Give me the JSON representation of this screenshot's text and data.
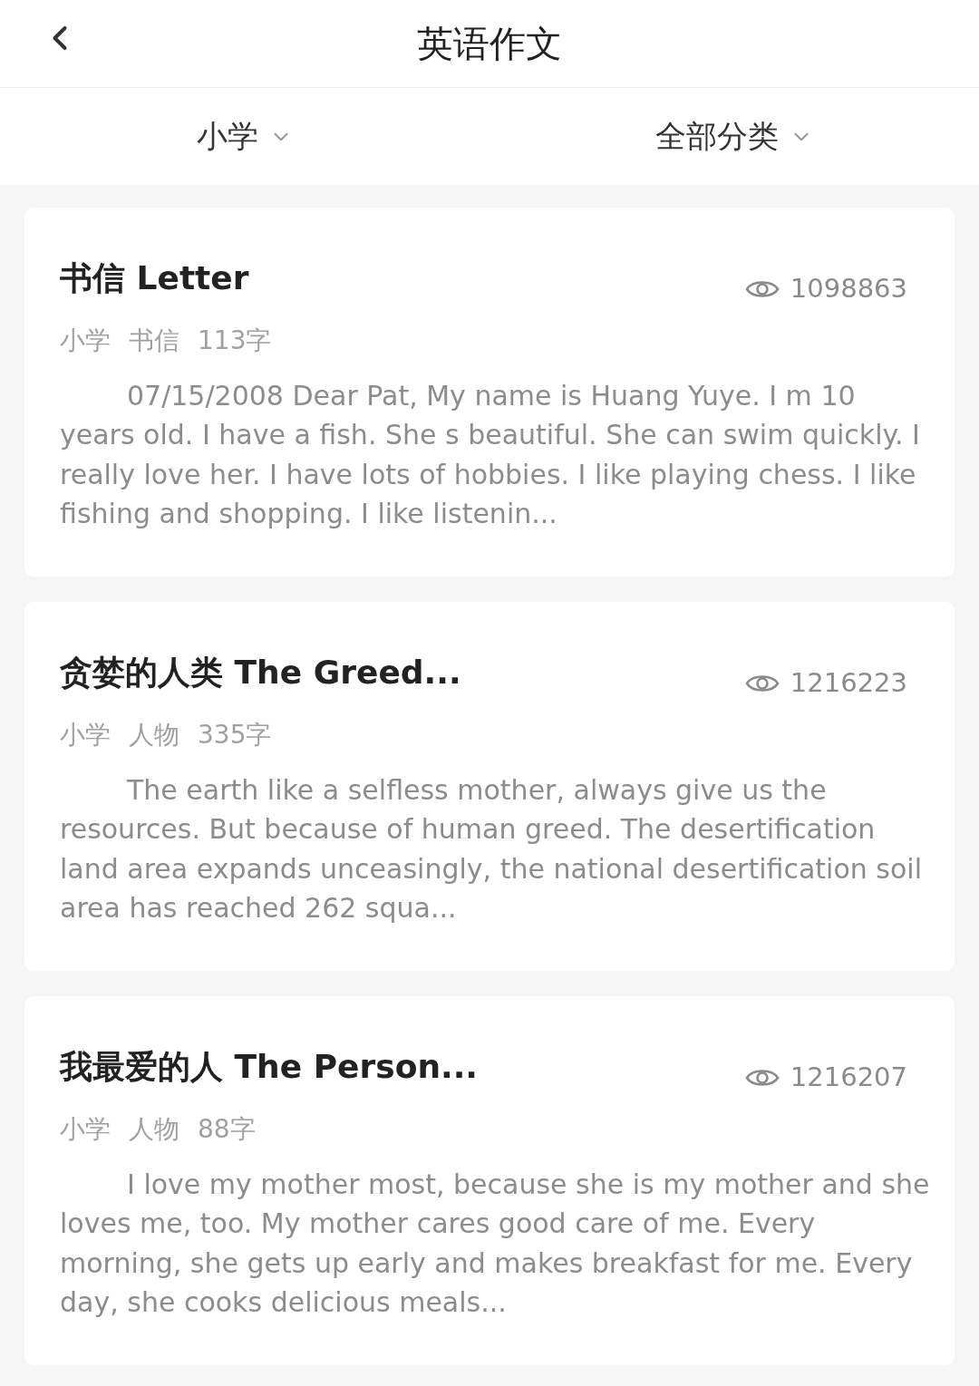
{
  "header": {
    "title": "英语作文"
  },
  "filters": [
    {
      "label": "小学"
    },
    {
      "label": "全部分类"
    }
  ],
  "articles": [
    {
      "title": "书信 Letter",
      "views": "1098863",
      "meta": [
        "小学",
        "书信",
        "113字"
      ],
      "excerpt": "07/15/2008  Dear Pat,  My name is Huang Yuye. I m 10 years old. I have a fish. She s beautiful. She can swim quickly. I really love her. I have lots of hobbies. I like playing chess. I like fishing and shopping. I like listenin..."
    },
    {
      "title": "贪婪的人类  The Greed...",
      "views": "1216223",
      "meta": [
        "小学",
        "人物",
        "335字"
      ],
      "excerpt": "The earth like a selfless mother, always give us the resources. But because of human greed. The desertification land area expands unceasingly, the national desertification soil area has reached 262 squa..."
    },
    {
      "title": "我最爱的人 The Person...",
      "views": "1216207",
      "meta": [
        "小学",
        "人物",
        "88字"
      ],
      "excerpt": "I love my mother most, because she is my mother and she loves me, too. My mother cares good care of me. Every morning, she gets up early and makes breakfast for me. Every day, she cooks delicious meals..."
    }
  ]
}
